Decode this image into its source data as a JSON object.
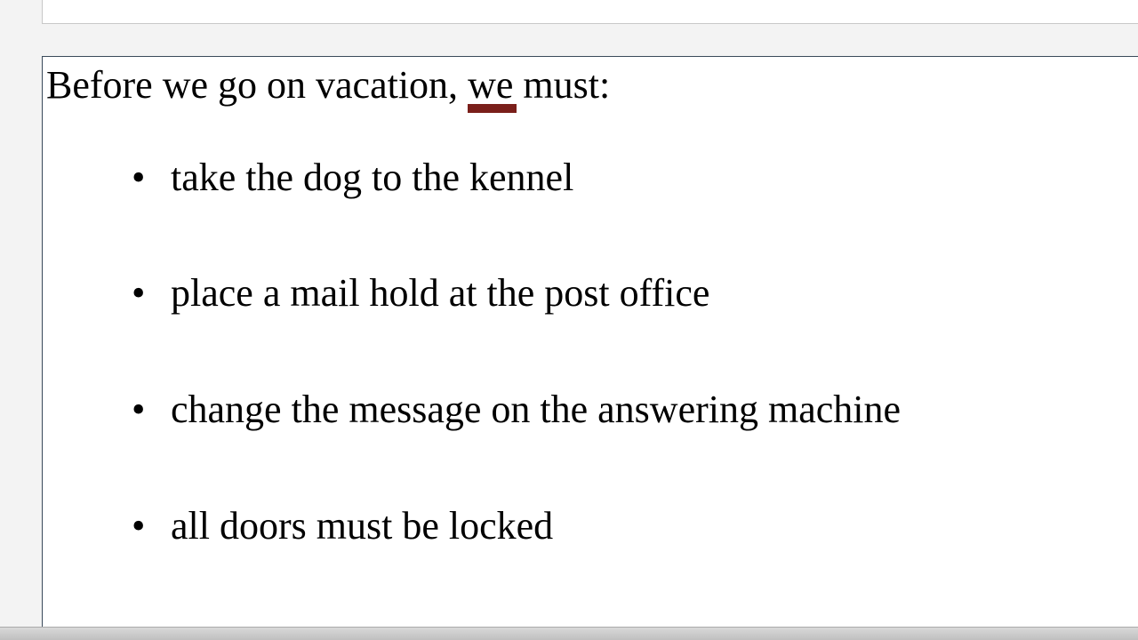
{
  "heading": {
    "before": "Before we go on vacation, ",
    "underlined": "we",
    "after": " must:"
  },
  "items": [
    "take the dog to the kennel",
    "place a mail hold at the post office",
    "change the message on the answering machine",
    "all doors must be locked"
  ],
  "underline_color": "#7a1f1a"
}
